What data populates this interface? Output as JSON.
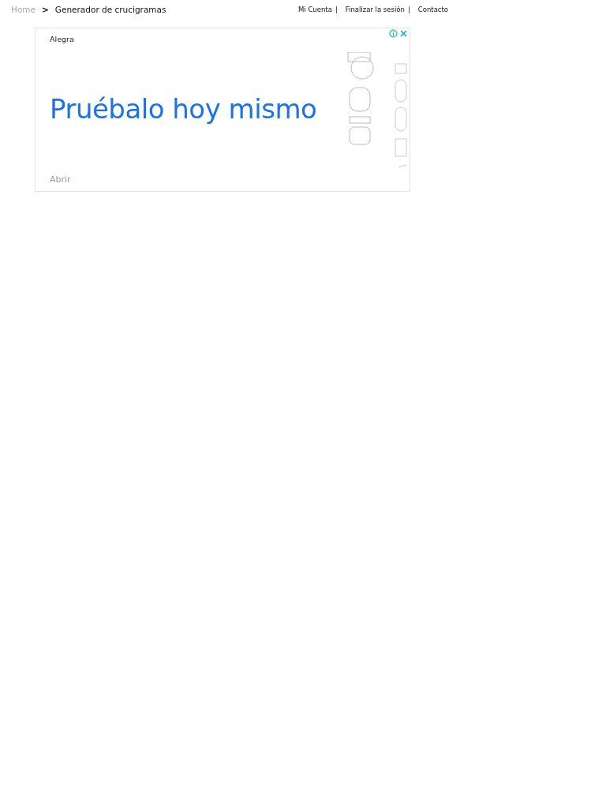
{
  "breadcrumb": {
    "items": [
      {
        "label": "Home",
        "current": false
      },
      {
        "label": "Generador de crucigramas",
        "current": true
      }
    ],
    "separator": ">"
  },
  "account_links": [
    {
      "label": "Mi Cuenta",
      "separator": "|"
    },
    {
      "label": "Finalizar la sesión",
      "separator": "|"
    },
    {
      "label": "Contacto"
    }
  ],
  "ad": {
    "advertiser": "Alegra",
    "headline": "Pruébalo hoy mismo",
    "cta": "Abrir"
  }
}
